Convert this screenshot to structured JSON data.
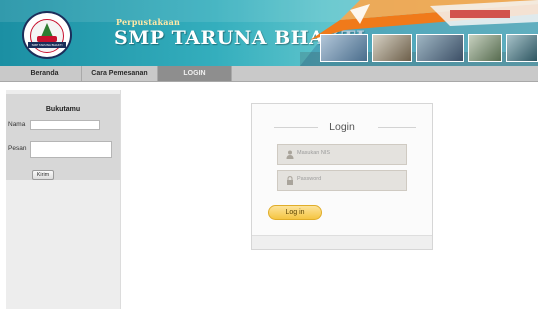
{
  "header": {
    "subtitle": "Perpustakaan",
    "title": "SMP TARUNA BHAKTI",
    "logo_text": "SMP TARUNA BHAKTI"
  },
  "nav": {
    "items": [
      {
        "label": "Beranda"
      },
      {
        "label": "Cara Pemesanan"
      },
      {
        "label": "LOGIN"
      }
    ]
  },
  "sidebar": {
    "guestbook_title": "Bukutamu",
    "name_label": "Nama",
    "message_label": "Pesan",
    "send_label": "Kirim"
  },
  "login": {
    "title": "Login",
    "nis_placeholder": "Masukan NIS",
    "password_placeholder": "Password",
    "button_label": "Log in"
  },
  "colors": {
    "header_teal": "#1b8fa3",
    "nav_active": "#8e8e8e",
    "login_button": "#f5c542"
  }
}
